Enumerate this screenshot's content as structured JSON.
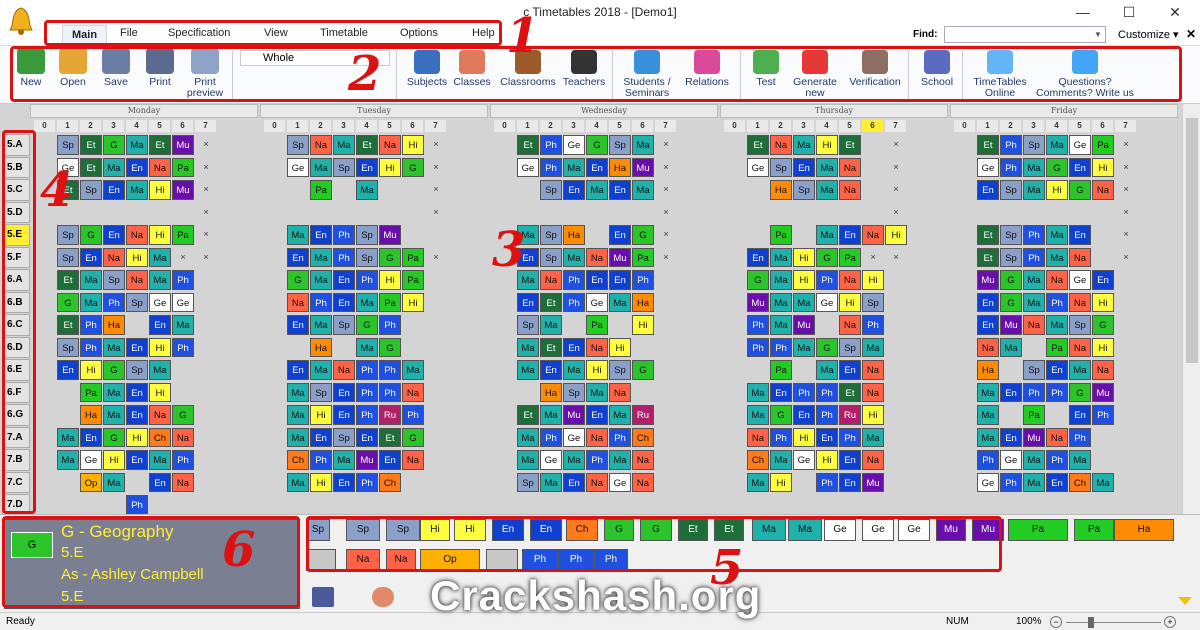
{
  "app": {
    "title": "c Timetables 2018  - [Demo1]"
  },
  "window": {
    "minimize": "—",
    "maximize": "☐",
    "close": "✕"
  },
  "menu": {
    "items": [
      "Main",
      "File",
      "Specification",
      "View",
      "Timetable",
      "Options",
      "Help"
    ],
    "find_label": "Find:",
    "find_value": "",
    "customize": "Customize ▾",
    "close": "✕"
  },
  "ribbon": {
    "scope": "Whole",
    "buttons": [
      {
        "label": "New",
        "color": "#3a9a3a"
      },
      {
        "label": "Open",
        "color": "#e6a636"
      },
      {
        "label": "Save",
        "color": "#6b7fa6"
      },
      {
        "label": "Print",
        "color": "#5b6b8f"
      },
      {
        "label": "Print preview",
        "color": "#8fa3c9"
      },
      {
        "label": "Subjects",
        "color": "#3a6fbf"
      },
      {
        "label": "Classes",
        "color": "#e07a5f"
      },
      {
        "label": "Classrooms",
        "color": "#9a5a2a"
      },
      {
        "label": "Teachers",
        "color": "#333333"
      },
      {
        "label": "Students / Seminars",
        "color": "#3a8fd9"
      },
      {
        "label": "Relations",
        "color": "#d94a9a"
      },
      {
        "label": "Test",
        "color": "#4caf50"
      },
      {
        "label": "Generate new",
        "color": "#e53935"
      },
      {
        "label": "Verification",
        "color": "#8d6e63"
      },
      {
        "label": "School",
        "color": "#5c6bc0"
      },
      {
        "label": "TimeTables Online",
        "color": "#64b5f6"
      },
      {
        "label": "Questions? Comments? Write us",
        "color": "#42a5f5"
      }
    ]
  },
  "grid": {
    "days": [
      "Monday",
      "Tuesday",
      "Wednesday",
      "Thursday",
      "Friday"
    ],
    "periods": [
      "0",
      "1",
      "2",
      "3",
      "4",
      "5",
      "6",
      "7"
    ],
    "classes": [
      "5.A",
      "5.B",
      "5.C",
      "5.D",
      "5.E",
      "5.F",
      "6.A",
      "6.B",
      "6.C",
      "6.D",
      "6.E",
      "6.F",
      "6.G",
      "7.A",
      "7.B",
      "7.C",
      "7.D"
    ],
    "highlight_class": "5.E",
    "highlight_period": "6",
    "empty_mark": "×",
    "colors": {
      "Sp": "#8aa0c8",
      "Ge": "#ffffff",
      "Et": "#1f6e3a",
      "G": "#2bc42b",
      "Ma": "#20b2aa",
      "En": "#1040d0",
      "Mu": "#6a0dad",
      "Na": "#ff6347",
      "Hi": "#ffff40",
      "Pa": "#22cc22",
      "Ha": "#ff8c00",
      "Ph": "#2050e0",
      "Op": "#ffb000",
      "Ch": "#ff7a1a",
      "Ru": "#b0206a",
      "Ar": "#b02020"
    },
    "rows": [
      [
        "",
        "Sp",
        "Et",
        "G",
        "Ma",
        "Et",
        "Mu",
        "×",
        "",
        "Sp",
        "Na",
        "Ma",
        "Et",
        "Na",
        "Hi",
        "×",
        "",
        "Et",
        "Ph",
        "Ge",
        "G",
        "Sp",
        "Ma",
        "×",
        "",
        "Et",
        "Na",
        "Ma",
        "Hi",
        "Et",
        "",
        "×",
        "",
        "Et",
        "Ph",
        "Sp",
        "Ma",
        "Ge",
        "Pa",
        "×"
      ],
      [
        "",
        "Ge",
        "Et",
        "Ma",
        "En",
        "Na",
        "Pa",
        "×",
        "",
        "Ge",
        "Ma",
        "Sp",
        "En",
        "Hi",
        "G",
        "×",
        "",
        "Ge",
        "Ph",
        "Ma",
        "En",
        "Ha",
        "Mu",
        "×",
        "",
        "Ge",
        "Sp",
        "En",
        "Ma",
        "Na",
        "",
        "×",
        "",
        "Ge",
        "Ph",
        "Ma",
        "G",
        "En",
        "Hi",
        "×"
      ],
      [
        "",
        "Et",
        "Sp",
        "En",
        "Ma",
        "Hi",
        "Mu",
        "×",
        "",
        "",
        "Pa",
        "",
        "Ma",
        "",
        "",
        "×",
        "",
        "",
        "Sp",
        "En",
        "Ma",
        "En",
        "Ma",
        "×",
        "",
        "",
        "Ha",
        "Sp",
        "Ma",
        "Na",
        "",
        "×",
        "",
        "En",
        "Sp",
        "Ma",
        "Hi",
        "G",
        "Na",
        "×"
      ],
      [
        "",
        "",
        "",
        "",
        "",
        "",
        "",
        "×",
        "",
        "",
        "",
        "",
        "",
        "",
        "",
        "×",
        "",
        "",
        "",
        "",
        "",
        "",
        "",
        "×",
        "",
        "",
        "",
        "",
        "",
        "",
        "",
        "×",
        "",
        "",
        "",
        "",
        "",
        "",
        "",
        "×"
      ],
      [
        "",
        "Sp",
        "G",
        "En",
        "Na",
        "Hi",
        "Pa",
        "×",
        "",
        "Ma",
        "En",
        "Ph",
        "Sp",
        "Mu",
        "",
        "",
        "",
        "Ma",
        "Sp",
        "Ha",
        "",
        "En",
        "G",
        "×",
        "",
        "",
        "Pa",
        "",
        "Ma",
        "En",
        "Na",
        "Hi",
        "",
        "Et",
        "Sp",
        "Ph",
        "Ma",
        "En",
        "",
        "×"
      ],
      [
        "",
        "Sp",
        "En",
        "Na",
        "Hi",
        "Ma",
        "×",
        "×",
        "",
        "En",
        "Ma",
        "Ph",
        "Sp",
        "G",
        "Pa",
        "×",
        "",
        "En",
        "Sp",
        "Ma",
        "Na",
        "Mu",
        "Pa",
        "×",
        "",
        "En",
        "Ma",
        "Hi",
        "G",
        "Pa",
        "×",
        "×",
        "",
        "Et",
        "Sp",
        "Ph",
        "Ma",
        "Na",
        "",
        "×"
      ],
      [
        "",
        "Et",
        "Ma",
        "Sp",
        "Na",
        "Ma",
        "Ph",
        "",
        "",
        "G",
        "Ma",
        "En",
        "Ph",
        "Hi",
        "Pa",
        "",
        "",
        "Ma",
        "Na",
        "Ph",
        "En",
        "En",
        "Ph",
        "",
        "",
        "G",
        "Ma",
        "Hi",
        "Ph",
        "Na",
        "Hi",
        "",
        "",
        "Mu",
        "G",
        "Ma",
        "Na",
        "Ge",
        "En",
        ""
      ],
      [
        "",
        "G",
        "Ma",
        "Ph",
        "Sp",
        "Ge",
        "Ge",
        "",
        "",
        "Na",
        "Ph",
        "En",
        "Ma",
        "Pa",
        "Hi",
        "",
        "",
        "En",
        "Et",
        "Ph",
        "Ge",
        "Ma",
        "Ha",
        "",
        "",
        "Mu",
        "Ma",
        "Ma",
        "Ge",
        "Hi",
        "Sp",
        "",
        "",
        "En",
        "G",
        "Ma",
        "Ph",
        "Na",
        "Hi",
        ""
      ],
      [
        "",
        "Et",
        "Ph",
        "Ha",
        "",
        "En",
        "Ma",
        "",
        "",
        "En",
        "Ma",
        "Sp",
        "G",
        "Ph",
        "",
        "",
        "",
        "Sp",
        "Ma",
        "",
        "Pa",
        "",
        "Hi",
        "",
        "",
        "Ph",
        "Ma",
        "Mu",
        "",
        "Na",
        "Ph",
        "",
        "",
        "En",
        "Mu",
        "Na",
        "Ma",
        "Sp",
        "G",
        ""
      ],
      [
        "",
        "Sp",
        "Ph",
        "Ma",
        "En",
        "Hi",
        "Ph",
        "",
        "",
        "",
        "Ha",
        "",
        "Ma",
        "G",
        "",
        "",
        "",
        "Ma",
        "Et",
        "En",
        "Na",
        "Hi",
        "",
        "",
        "",
        "Ph",
        "Ph",
        "Ma",
        "G",
        "Sp",
        "Ma",
        "",
        "",
        "Na",
        "Ma",
        "",
        "Pa",
        "Na",
        "Hi",
        ""
      ],
      [
        "",
        "En",
        "Hi",
        "G",
        "Sp",
        "Ma",
        "",
        "",
        "",
        "En",
        "Ma",
        "Na",
        "Ph",
        "Ph",
        "Ma",
        "",
        "",
        "Ma",
        "En",
        "Ma",
        "Hi",
        "Sp",
        "G",
        "",
        "",
        "",
        "Pa",
        "",
        "Ma",
        "En",
        "Na",
        "",
        "",
        "Ha",
        "",
        "Sp",
        "En",
        "Ma",
        "Na",
        ""
      ],
      [
        "",
        "",
        "Pa",
        "Ma",
        "En",
        "Hi",
        "",
        "",
        "",
        "Ma",
        "Sp",
        "En",
        "Ph",
        "Ph",
        "Na",
        "",
        "",
        "",
        "Ha",
        "Sp",
        "Ma",
        "Na",
        "",
        "",
        "",
        "Ma",
        "En",
        "Ph",
        "Ph",
        "Et",
        "Na",
        "",
        "",
        "Ma",
        "En",
        "Ph",
        "Ph",
        "G",
        "Mu",
        ""
      ],
      [
        "",
        "",
        "Ha",
        "Ma",
        "En",
        "Na",
        "G",
        "",
        "",
        "Ma",
        "Hi",
        "En",
        "Ph",
        "Ru",
        "Ph",
        "",
        "",
        "Et",
        "Ma",
        "Mu",
        "En",
        "Ma",
        "Ru",
        "",
        "",
        "Ma",
        "G",
        "En",
        "Ph",
        "Ru",
        "Hi",
        "",
        "",
        "Ma",
        "",
        "Pa",
        "",
        "En",
        "Ph",
        ""
      ],
      [
        "",
        "Ma",
        "En",
        "G",
        "Hi",
        "Ch",
        "Na",
        "",
        "",
        "Ma",
        "En",
        "Sp",
        "En",
        "Et",
        "G",
        "",
        "",
        "Ma",
        "Ph",
        "Ge",
        "Na",
        "Ph",
        "Ch",
        "",
        "",
        "Na",
        "Ph",
        "Hi",
        "En",
        "Ph",
        "Ma",
        "",
        "",
        "Ma",
        "En",
        "Mu",
        "Na",
        "Ph",
        "",
        ""
      ],
      [
        "",
        "Ma",
        "Ge",
        "Hi",
        "En",
        "Ma",
        "Ph",
        "",
        "",
        "Ch",
        "Ph",
        "Ma",
        "Mu",
        "En",
        "Na",
        "",
        "",
        "Ma",
        "Ge",
        "Ma",
        "Ph",
        "Ma",
        "Na",
        "",
        "",
        "Ch",
        "Ma",
        "Ge",
        "Hi",
        "En",
        "Na",
        "",
        "",
        "Ph",
        "Ge",
        "Ma",
        "Ph",
        "Ma",
        "",
        ""
      ],
      [
        "",
        "",
        "Op",
        "Ma",
        "",
        "En",
        "Na",
        "",
        "",
        "Ma",
        "Hi",
        "En",
        "Ph",
        "Ch",
        "",
        "",
        "",
        "Sp",
        "Ma",
        "En",
        "Na",
        "Ge",
        "Na",
        "",
        "",
        "Ma",
        "Hi",
        "",
        "Ph",
        "En",
        "Mu",
        "",
        "",
        "Ge",
        "Ph",
        "Ma",
        "En",
        "Ch",
        "Ma",
        ""
      ],
      [
        "",
        "",
        "",
        "",
        "Ph",
        "",
        "",
        "",
        "",
        "",
        "",
        "",
        "",
        "",
        "",
        "",
        "",
        "",
        "",
        "",
        "",
        "",
        "",
        "",
        "",
        "",
        "",
        "",
        "",
        "",
        "",
        "",
        "",
        "",
        "",
        "",
        "",
        "",
        "",
        ""
      ]
    ]
  },
  "info": {
    "card": "G",
    "subject": "G - Geography",
    "class1": "5.E",
    "teacher": "As - Ashley Campbell",
    "class2": "5.E"
  },
  "palette": [
    "Sp",
    "Sp",
    "Sp",
    "Hi",
    "Hi",
    "En",
    "En",
    "Ch",
    "G",
    "G",
    "Et",
    "Et",
    "Ma",
    "Ma",
    "Ge",
    "Ge",
    "Ge",
    "Mu",
    "Mu",
    "Pa",
    "Pa",
    "Ha",
    "",
    "Na",
    "Na",
    "Op",
    "",
    "Ph",
    "Ph",
    "Ph"
  ],
  "status": {
    "ready": "Ready",
    "num": "NUM",
    "zoom": "100%"
  },
  "annotations": [
    "1",
    "2",
    "3",
    "4",
    "5",
    "6"
  ],
  "watermark": "Crackshash.org"
}
